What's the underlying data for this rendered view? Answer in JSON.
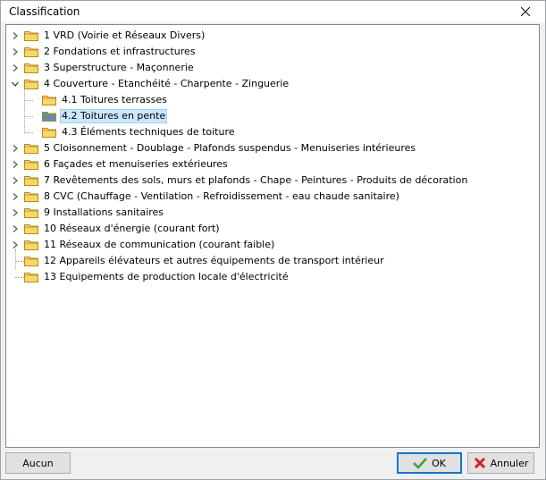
{
  "window": {
    "title": "Classification"
  },
  "tree": {
    "items": [
      {
        "label": "1 VRD (Voirie et Réseaux Divers)"
      },
      {
        "label": "2 Fondations et infrastructures"
      },
      {
        "label": "3 Superstructure - Maçonnerie"
      },
      {
        "label": "4 Couverture - Etanchéité - Charpente - Zinguerie",
        "expanded": true,
        "children": [
          {
            "label": "4.1 Toitures terrasses"
          },
          {
            "label": "4.2 Toitures en pente",
            "selected": true
          },
          {
            "label": "4.3 Éléments techniques de toiture"
          }
        ]
      },
      {
        "label": "5 Cloisonnement - Doublage - Plafonds suspendus - Menuiseries intérieures"
      },
      {
        "label": "6 Façades et menuiseries extérieures"
      },
      {
        "label": "7 Revêtements des sols, murs et plafonds - Chape - Peintures - Produits de décoration"
      },
      {
        "label": "8 CVC (Chauffage - Ventilation - Refroidissement - eau chaude sanitaire)"
      },
      {
        "label": "9 Installations sanitaires"
      },
      {
        "label": "10 Réseaux d'énergie (courant fort)"
      },
      {
        "label": "11 Réseaux de communication (courant faible)"
      },
      {
        "label": "12 Appareils élévateurs et autres équipements de transport intérieur"
      },
      {
        "label": "13 Equipements de production locale d'électricité"
      }
    ]
  },
  "buttons": {
    "none_label": "Aucun",
    "ok_label": "OK",
    "cancel_label": "Annuler"
  },
  "colors": {
    "folder": "#ffd75e",
    "folder_selected": "#5b8fb0",
    "accent": "#0078d7",
    "selection": "#cce8ff"
  }
}
